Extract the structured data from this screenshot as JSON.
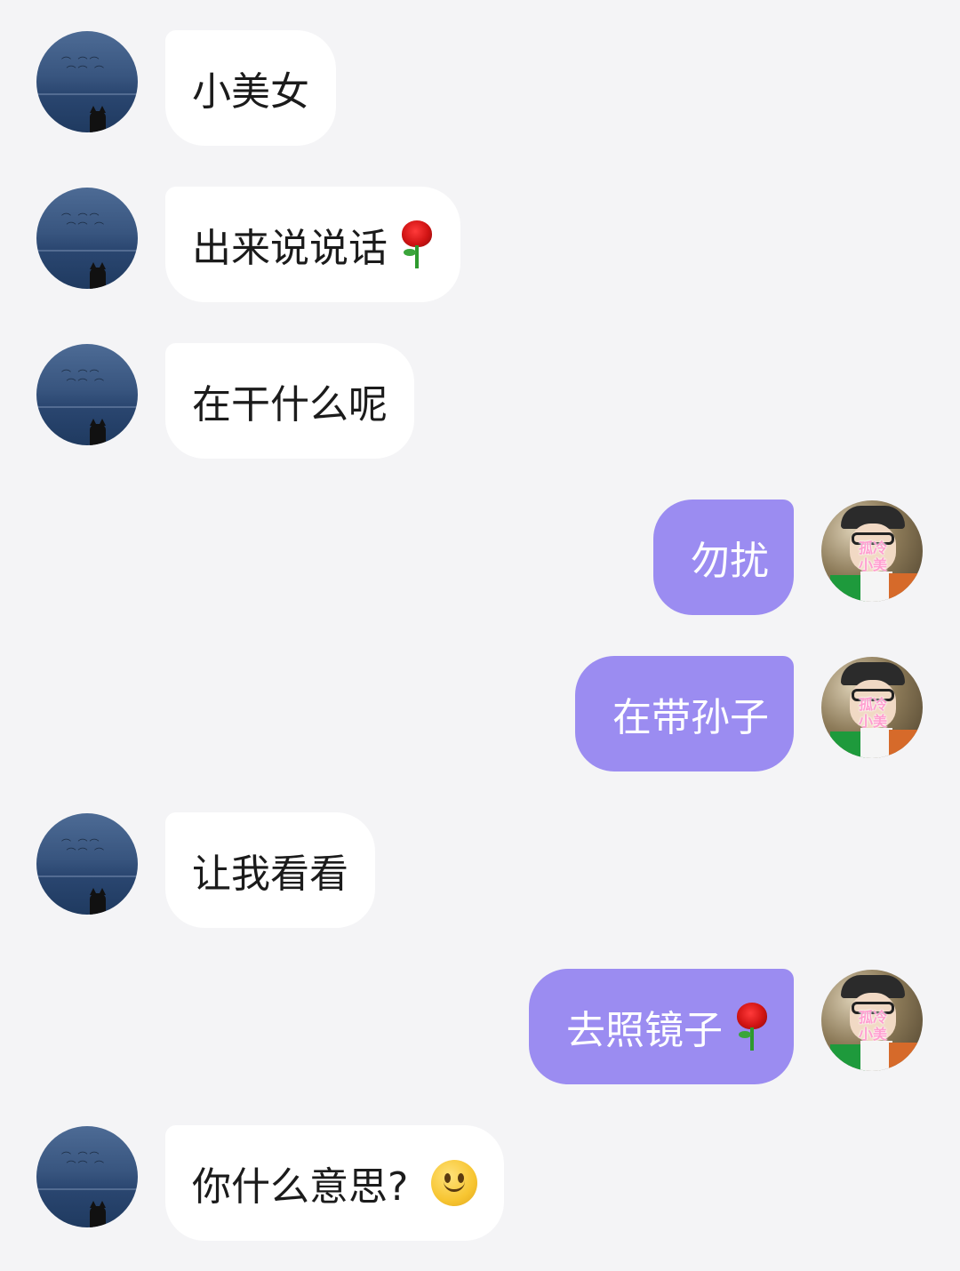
{
  "chat": {
    "messages": [
      {
        "sender": "other",
        "avatar": "sea-birds-cat-avatar",
        "text": "小美女"
      },
      {
        "sender": "other",
        "avatar": "sea-birds-cat-avatar",
        "text": "出来说说话",
        "emoji": "rose-icon"
      },
      {
        "sender": "other",
        "avatar": "sea-birds-cat-avatar",
        "text": "在干什么呢"
      },
      {
        "sender": "self",
        "avatar": "sticker-photo-avatar",
        "text": "勿扰"
      },
      {
        "sender": "self",
        "avatar": "sticker-photo-avatar",
        "text": "在带孙子"
      },
      {
        "sender": "other",
        "avatar": "sea-birds-cat-avatar",
        "text": "让我看看"
      },
      {
        "sender": "self",
        "avatar": "sticker-photo-avatar",
        "text": "去照镜子",
        "emoji": "rose-icon"
      },
      {
        "sender": "other",
        "avatar": "sea-birds-cat-avatar",
        "text": "你什么意思?",
        "emoji": "smiley-icon"
      }
    ],
    "self_avatar_sticker": "孤冷\n小美",
    "colors": {
      "background": "#f4f4f6",
      "incoming_bubble": "#ffffff",
      "outgoing_bubble": "#9b8cf1",
      "incoming_text": "#1b1b1b",
      "outgoing_text": "#ffffff"
    }
  }
}
